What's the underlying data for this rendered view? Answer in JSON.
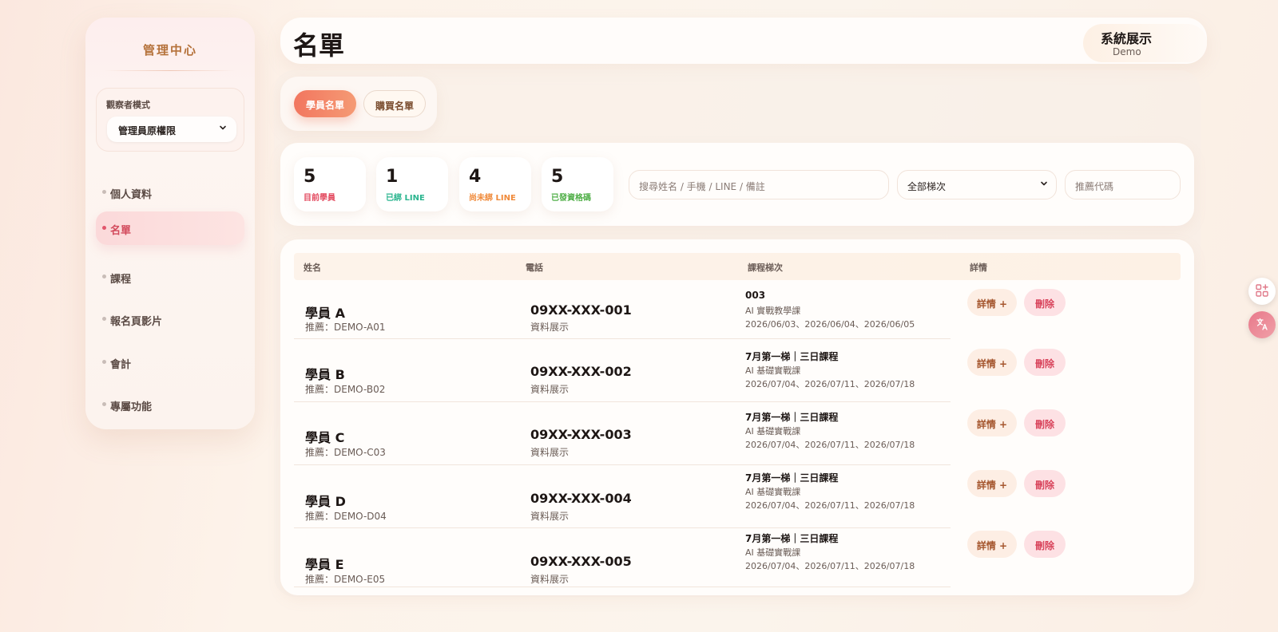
{
  "sidebar": {
    "title": "管理中心",
    "observer": {
      "label": "觀察者模式",
      "selected": "管理員原權限"
    },
    "items": [
      {
        "label": "個人資料"
      },
      {
        "label": "名單"
      },
      {
        "label": "課程"
      },
      {
        "label": "報名頁影片"
      },
      {
        "label": "會計"
      },
      {
        "label": "專屬功能"
      }
    ]
  },
  "header": {
    "title": "名單",
    "user_name": "系統展示",
    "user_role": "Demo"
  },
  "tabs": [
    {
      "label": "學員名單"
    },
    {
      "label": "購買名單"
    }
  ],
  "stats": [
    {
      "value": "5",
      "label": "目前學員",
      "color": "#e34a5f"
    },
    {
      "value": "1",
      "label": "已綁 LINE",
      "color": "#2bb58f"
    },
    {
      "value": "4",
      "label": "尚未綁 LINE",
      "color": "#f08a3a"
    },
    {
      "value": "5",
      "label": "已發資格碼",
      "color": "#52b04a"
    }
  ],
  "filters": {
    "search_placeholder": "搜尋姓名 / 手機 / LINE / 備註",
    "batch_selected": "全部梯次",
    "referral_placeholder": "推薦代碼"
  },
  "table": {
    "headers": [
      "姓名",
      "電話",
      "課程梯次",
      "詳情"
    ],
    "detail_label": "詳情 +",
    "delete_label": "刪除",
    "rows": [
      {
        "name": "學員 A",
        "ref": "推薦：DEMO-A01",
        "phone": "09XX-XXX-001",
        "phone_sub": "資料展示",
        "course_title": "003",
        "course_type": "AI 實戰教學課",
        "course_dates": "2026/06/03、2026/06/04、2026/06/05"
      },
      {
        "name": "學員 B",
        "ref": "推薦：DEMO-B02",
        "phone": "09XX-XXX-002",
        "phone_sub": "資料展示",
        "course_title": "7月第一梯｜三日課程",
        "course_type": "AI 基礎實戰課",
        "course_dates": "2026/07/04、2026/07/11、2026/07/18"
      },
      {
        "name": "學員 C",
        "ref": "推薦：DEMO-C03",
        "phone": "09XX-XXX-003",
        "phone_sub": "資料展示",
        "course_title": "7月第一梯｜三日課程",
        "course_type": "AI 基礎實戰課",
        "course_dates": "2026/07/04、2026/07/11、2026/07/18"
      },
      {
        "name": "學員 D",
        "ref": "推薦：DEMO-D04",
        "phone": "09XX-XXX-004",
        "phone_sub": "資料展示",
        "course_title": "7月第一梯｜三日課程",
        "course_type": "AI 基礎實戰課",
        "course_dates": "2026/07/04、2026/07/11、2026/07/18"
      },
      {
        "name": "學員 E",
        "ref": "推薦：DEMO-E05",
        "phone": "09XX-XXX-005",
        "phone_sub": "資料展示",
        "course_title": "7月第一梯｜三日課程",
        "course_type": "AI 基礎實戰課",
        "course_dates": "2026/07/04、2026/07/11、2026/07/18"
      }
    ]
  },
  "icons": {
    "float_top": "apps-plus-icon",
    "float_bottom": "translate-icon"
  }
}
